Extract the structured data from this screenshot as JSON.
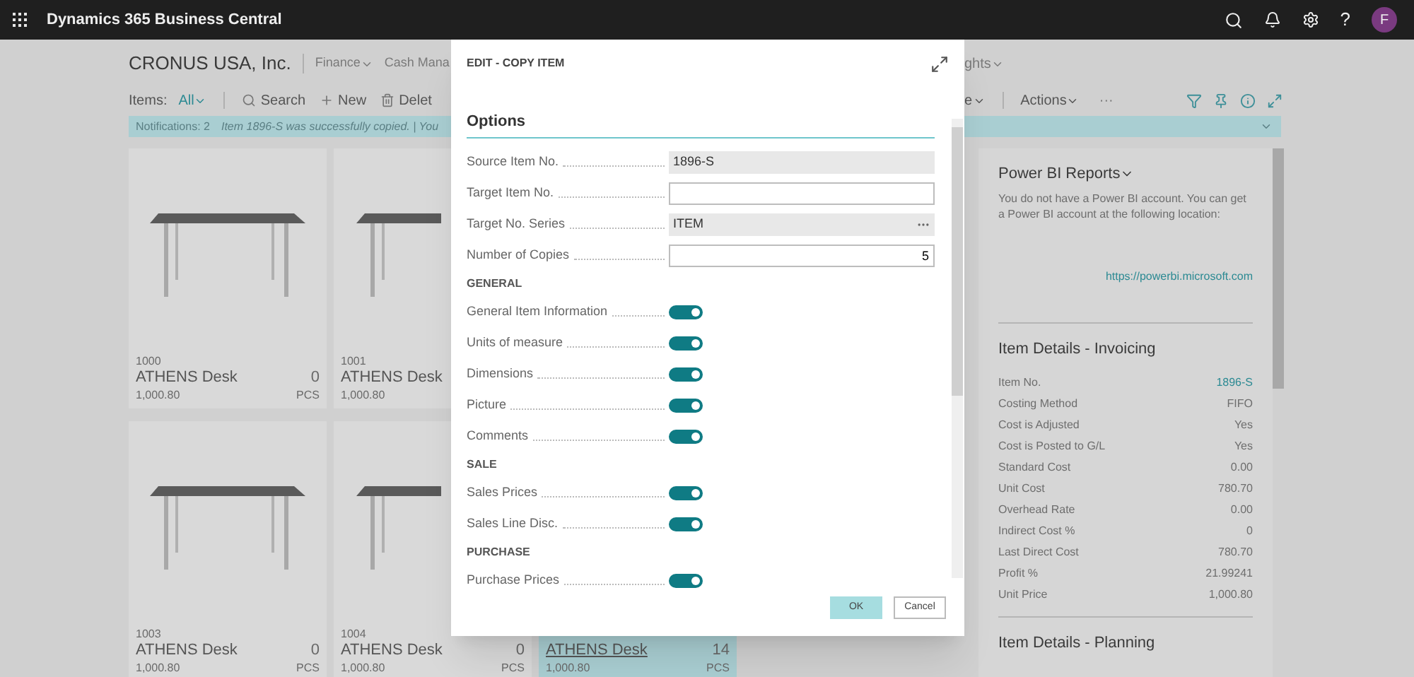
{
  "app_bar": {
    "title": "Dynamics 365 Business Central",
    "help": "?",
    "avatar": "F"
  },
  "nav": {
    "company": "CRONUS USA, Inc.",
    "menus_left": [
      "Finance",
      "Cash Mana"
    ],
    "menus_right": [
      "ghts"
    ]
  },
  "toolbar": {
    "view_label": "Items:",
    "view": "All",
    "left": [
      {
        "label": "Search",
        "kind": "search"
      },
      {
        "label": "New",
        "kind": "new"
      },
      {
        "label": "Delet",
        "kind": "delete"
      }
    ],
    "right_menus": [
      "e",
      "Actions"
    ],
    "more": "···"
  },
  "notification": {
    "count": "Notifications: 2",
    "message": "Item 1896-S was successfully copied. | You"
  },
  "cards": [
    [
      {
        "number": "1000",
        "name": "ATHENS Desk",
        "quantity": "0",
        "unit": "PCS",
        "price": "1,000.80",
        "selected": false
      },
      {
        "number": "1001",
        "name": "ATHENS Desk",
        "price": "1,000.80",
        "selected": false
      }
    ],
    [
      {
        "number": "1003",
        "name": "ATHENS Desk",
        "quantity": "0",
        "unit": "PCS",
        "price": "1,000.80",
        "selected": false
      },
      {
        "number": "1004",
        "name": "ATHENS Desk",
        "quantity": "0",
        "unit": "PCS",
        "price": "1,000.80",
        "selected": false
      },
      {
        "name": "ATHENS Desk",
        "quantity": "14",
        "unit": "PCS",
        "price": "1,000.80",
        "selected": true
      }
    ]
  ],
  "factbox": {
    "power_bi": {
      "title": "Power BI Reports",
      "text": "You do not have a Power BI account. You can get a Power BI account at the following location:",
      "link": "https://powerbi.microsoft.com"
    },
    "sections": [
      {
        "title": "Item Details - Invoicing",
        "rows": [
          {
            "label": "Item No.",
            "value": "1896-S",
            "kind": "link"
          },
          {
            "label": "Costing Method",
            "value": "FIFO",
            "kind": "text"
          },
          {
            "label": "Cost is Adjusted",
            "value": "Yes",
            "kind": "text"
          },
          {
            "label": "Cost is Posted to G/L",
            "value": "Yes",
            "kind": "text"
          },
          {
            "label": "Standard Cost",
            "value": "0.00",
            "kind": "text"
          },
          {
            "label": "Unit Cost",
            "value": "780.70",
            "kind": "text"
          },
          {
            "label": "Overhead Rate",
            "value": "0.00",
            "kind": "text"
          },
          {
            "label": "Indirect Cost %",
            "value": "0",
            "kind": "text"
          },
          {
            "label": "Last Direct Cost",
            "value": "780.70",
            "kind": "text"
          },
          {
            "label": "Profit %",
            "value": "21.99241",
            "kind": "text"
          },
          {
            "label": "Unit Price",
            "value": "1,000.80",
            "kind": "text"
          }
        ]
      },
      {
        "title": "Item Details - Planning"
      }
    ]
  },
  "dialog": {
    "title": "EDIT - COPY ITEM",
    "section": "Options",
    "fields": [
      {
        "label": "Source Item No.",
        "value": "1896-S",
        "kind": "readonly"
      },
      {
        "label": "Target Item No.",
        "kind": "input"
      },
      {
        "label": "Target No. Series",
        "value": "ITEM",
        "kind": "lookup"
      },
      {
        "label": "Number of Copies",
        "value": "5",
        "kind": "number"
      }
    ],
    "groups": [
      {
        "title": "GENERAL",
        "options": [
          {
            "label": "General Item Information",
            "on": true
          },
          {
            "label": "Units of measure",
            "on": true
          },
          {
            "label": "Dimensions",
            "on": true
          },
          {
            "label": "Picture",
            "on": true
          },
          {
            "label": "Comments",
            "on": true
          }
        ]
      },
      {
        "title": "SALE",
        "options": [
          {
            "label": "Sales Prices",
            "on": true
          },
          {
            "label": "Sales Line Disc.",
            "on": true
          }
        ]
      },
      {
        "title": "PURCHASE",
        "options": [
          {
            "label": "Purchase Prices",
            "on": true
          }
        ]
      }
    ],
    "buttons": [
      {
        "label": "OK",
        "kind": "primary"
      },
      {
        "label": "Cancel",
        "kind": "secondary"
      }
    ]
  }
}
